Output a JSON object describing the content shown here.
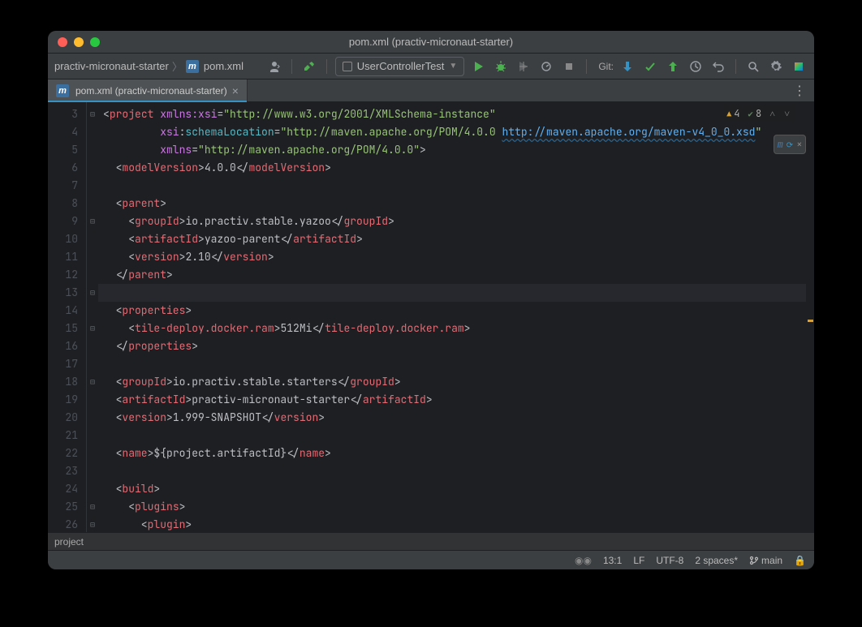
{
  "window": {
    "title": "pom.xml (practiv-micronaut-starter)"
  },
  "breadcrumbs": {
    "project": "practiv-micronaut-starter",
    "file": "pom.xml"
  },
  "run_config": {
    "label": "UserControllerTest"
  },
  "git_label": "Git:",
  "tab": {
    "label": "pom.xml (practiv-micronaut-starter)"
  },
  "inspections": {
    "warnings": "4",
    "weak": "8"
  },
  "gutter_start": 3,
  "gutter_end": 26,
  "folds": [
    "⊟",
    "",
    "",
    "",
    "",
    "",
    "⊟",
    "",
    "",
    "",
    "⊟",
    "",
    "⊟",
    "",
    "",
    "⊟",
    "",
    "",
    "",
    "",
    "",
    "",
    "⊟",
    "⊟",
    "⊟",
    ""
  ],
  "code_lines": [
    [
      [
        "p",
        "<"
      ],
      [
        "tg",
        "project"
      ],
      [
        "p",
        " "
      ],
      [
        "ns",
        "xmlns:xsi"
      ],
      [
        "p",
        "="
      ],
      [
        "av",
        "\"http://www.w3.org/2001/XMLSchema-instance\""
      ]
    ],
    [
      [
        "p",
        "         "
      ],
      [
        "ns",
        "xsi"
      ],
      [
        "p",
        ":"
      ],
      [
        "an",
        "schemaLocation"
      ],
      [
        "p",
        "="
      ],
      [
        "av",
        "\"http://maven.apache.org/POM/4.0.0 "
      ],
      [
        "lnk",
        "http://maven.apache.org/maven-v4_0_0.xsd"
      ],
      [
        "av",
        "\""
      ]
    ],
    [
      [
        "p",
        "         "
      ],
      [
        "ns",
        "xmlns"
      ],
      [
        "p",
        "="
      ],
      [
        "av",
        "\"http://maven.apache.org/POM/4.0.0\""
      ],
      [
        "p",
        ">"
      ]
    ],
    [
      [
        "p",
        "  <"
      ],
      [
        "tg",
        "modelVersion"
      ],
      [
        "p",
        ">"
      ],
      [
        "tx",
        "4.0.0"
      ],
      [
        "p",
        "</"
      ],
      [
        "tg",
        "modelVersion"
      ],
      [
        "p",
        ">"
      ]
    ],
    [],
    [
      [
        "p",
        "  <"
      ],
      [
        "tg",
        "parent"
      ],
      [
        "p",
        ">"
      ]
    ],
    [
      [
        "p",
        "    <"
      ],
      [
        "tg",
        "groupId"
      ],
      [
        "p",
        ">"
      ],
      [
        "tx",
        "io.practiv.stable.yazoo"
      ],
      [
        "p",
        "</"
      ],
      [
        "tg",
        "groupId"
      ],
      [
        "p",
        ">"
      ]
    ],
    [
      [
        "p",
        "    <"
      ],
      [
        "tg",
        "artifactId"
      ],
      [
        "p",
        ">"
      ],
      [
        "tx",
        "yazoo-parent"
      ],
      [
        "p",
        "</"
      ],
      [
        "tg",
        "artifactId"
      ],
      [
        "p",
        ">"
      ]
    ],
    [
      [
        "p",
        "    <"
      ],
      [
        "tg",
        "version"
      ],
      [
        "p",
        ">"
      ],
      [
        "tx",
        "2.10"
      ],
      [
        "p",
        "</"
      ],
      [
        "tg",
        "version"
      ],
      [
        "p",
        ">"
      ]
    ],
    [
      [
        "p",
        "  </"
      ],
      [
        "tg",
        "parent"
      ],
      [
        "p",
        ">"
      ]
    ],
    [],
    [
      [
        "p",
        "  <"
      ],
      [
        "tg",
        "properties"
      ],
      [
        "p",
        ">"
      ]
    ],
    [
      [
        "p",
        "    <"
      ],
      [
        "tg",
        "tile-deploy.docker.ram"
      ],
      [
        "p",
        ">"
      ],
      [
        "tx",
        "512Mi"
      ],
      [
        "p",
        "</"
      ],
      [
        "tg",
        "tile-deploy.docker.ram"
      ],
      [
        "p",
        ">"
      ]
    ],
    [
      [
        "p",
        "  </"
      ],
      [
        "tg",
        "properties"
      ],
      [
        "p",
        ">"
      ]
    ],
    [],
    [
      [
        "p",
        "  <"
      ],
      [
        "tg",
        "groupId"
      ],
      [
        "p",
        ">"
      ],
      [
        "tx",
        "io.practiv.stable.starters"
      ],
      [
        "p",
        "</"
      ],
      [
        "tg",
        "groupId"
      ],
      [
        "p",
        ">"
      ]
    ],
    [
      [
        "p",
        "  <"
      ],
      [
        "tg",
        "artifactId"
      ],
      [
        "p",
        ">"
      ],
      [
        "tx",
        "practiv-micronaut-starter"
      ],
      [
        "p",
        "</"
      ],
      [
        "tg",
        "artifactId"
      ],
      [
        "p",
        ">"
      ]
    ],
    [
      [
        "p",
        "  <"
      ],
      [
        "tg",
        "version"
      ],
      [
        "p",
        ">"
      ],
      [
        "tx",
        "1.999-SNAPSHOT"
      ],
      [
        "p",
        "</"
      ],
      [
        "tg",
        "version"
      ],
      [
        "p",
        ">"
      ]
    ],
    [],
    [
      [
        "p",
        "  <"
      ],
      [
        "tg",
        "name"
      ],
      [
        "p",
        ">"
      ],
      [
        "tx",
        "${project.artifactId}"
      ],
      [
        "p",
        "</"
      ],
      [
        "tg",
        "name"
      ],
      [
        "p",
        ">"
      ]
    ],
    [],
    [
      [
        "p",
        "  <"
      ],
      [
        "tg",
        "build"
      ],
      [
        "p",
        ">"
      ]
    ],
    [
      [
        "p",
        "    <"
      ],
      [
        "tg",
        "plugins"
      ],
      [
        "p",
        ">"
      ]
    ],
    [
      [
        "p",
        "      <"
      ],
      [
        "tg",
        "plugin"
      ],
      [
        "p",
        ">"
      ]
    ]
  ],
  "bottom_crumb": "project",
  "status": {
    "caret": "13:1",
    "line_sep": "LF",
    "encoding": "UTF-8",
    "indent": "2 spaces*",
    "branch": "main"
  }
}
